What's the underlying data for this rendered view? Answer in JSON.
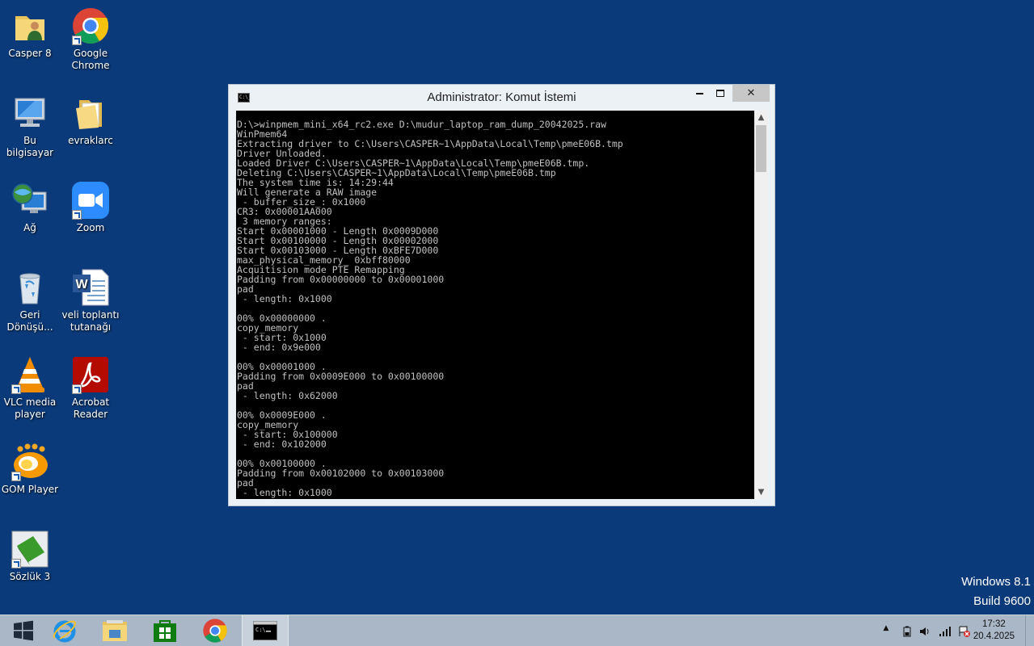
{
  "desktop": {
    "icons": [
      {
        "label": "Casper 8",
        "icon": "user-folder-icon"
      },
      {
        "label": "Google Chrome",
        "icon": "chrome-icon"
      },
      {
        "label": "Bu bilgisayar",
        "icon": "computer-icon"
      },
      {
        "label": "evraklarc",
        "icon": "folder-icon"
      },
      {
        "label": "Ağ",
        "icon": "network-icon"
      },
      {
        "label": "Zoom",
        "icon": "zoom-icon"
      },
      {
        "label": "Geri Dönüşü...",
        "icon": "recycle-bin-icon"
      },
      {
        "label": "veli toplantı tutanağı",
        "icon": "word-document-icon"
      },
      {
        "label": "VLC media player",
        "icon": "vlc-icon"
      },
      {
        "label": "Acrobat Reader",
        "icon": "acrobat-icon"
      },
      {
        "label": "GOM Player",
        "icon": "gom-player-icon"
      },
      {
        "label": "Sözlük 3",
        "icon": "dictionary-icon"
      }
    ]
  },
  "watermark": {
    "line1": "Windows 8.1",
    "line2": "Build 9600"
  },
  "window": {
    "title": "Administrator: Komut İstemi",
    "title_icon_text": "C:\\_",
    "close_glyph": "✕",
    "scroll_up": "▲",
    "scroll_down": "▼",
    "console_text": "D:\\>winpmem_mini_x64_rc2.exe D:\\mudur_laptop_ram_dump_20042025.raw\nWinPmem64\nExtracting driver to C:\\Users\\CASPER~1\\AppData\\Local\\Temp\\pmeE06B.tmp\nDriver Unloaded.\nLoaded Driver C:\\Users\\CASPER~1\\AppData\\Local\\Temp\\pmeE06B.tmp.\nDeleting C:\\Users\\CASPER~1\\AppData\\Local\\Temp\\pmeE06B.tmp\nThe system time is: 14:29:44\nWill generate a RAW image\n - buffer_size_: 0x1000\nCR3: 0x00001AA000\n 3 memory ranges:\nStart 0x00001000 - Length 0x0009D000\nStart 0x00100000 - Length 0x00002000\nStart 0x00103000 - Length 0xBFE7D000\nmax_physical_memory_ 0xbff80000\nAcquitision mode PTE Remapping\nPadding from 0x00000000 to 0x00001000\npad\n - length: 0x1000\n\n00% 0x00000000 .\ncopy_memory\n - start: 0x1000\n - end: 0x9e000\n\n00% 0x00001000 .\nPadding from 0x0009E000 to 0x00100000\npad\n - length: 0x62000\n\n00% 0x0009E000 .\ncopy_memory\n - start: 0x100000\n - end: 0x102000\n\n00% 0x00100000 .\nPadding from 0x00102000 to 0x00103000\npad\n - length: 0x1000"
  },
  "taskbar": {
    "apps": [
      "start-button",
      "internet-explorer",
      "file-explorer",
      "store",
      "chrome",
      "command-prompt"
    ],
    "clock": {
      "time": "17:32",
      "date": "20.4.2025"
    },
    "tray_up_glyph": "▲"
  },
  "colors": {
    "desktop_bg": "#0b3a7a",
    "taskbar_bg": "#a9b7c6",
    "console_bg": "#000000",
    "console_fg": "#c0c0c0"
  }
}
